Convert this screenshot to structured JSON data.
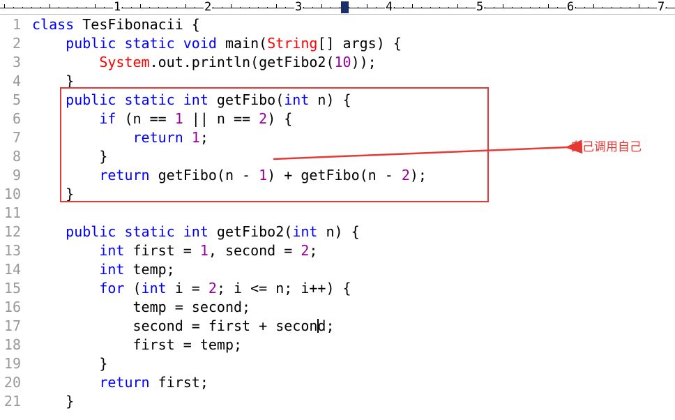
{
  "ruler": {
    "marks": [
      "1",
      "2",
      "3",
      "4",
      "5",
      "6",
      "7"
    ]
  },
  "editor": {
    "lines": [
      {
        "n": "1",
        "code": "class TesFibonacii {"
      },
      {
        "n": "2",
        "code": "    public static void main(String[] args) {"
      },
      {
        "n": "3",
        "code": "        System.out.println(getFibo2(10));"
      },
      {
        "n": "4",
        "code": "    }"
      },
      {
        "n": "5",
        "code": "    public static int getFibo(int n) {"
      },
      {
        "n": "6",
        "code": "        if (n == 1 || n == 2) {"
      },
      {
        "n": "7",
        "code": "            return 1;"
      },
      {
        "n": "8",
        "code": "        }"
      },
      {
        "n": "9",
        "code": "        return getFibo(n - 1) + getFibo(n - 2);"
      },
      {
        "n": "10",
        "code": "    }"
      },
      {
        "n": "11",
        "code": ""
      },
      {
        "n": "12",
        "code": "    public static int getFibo2(int n) {"
      },
      {
        "n": "13",
        "code": "        int first = 1, second = 2;"
      },
      {
        "n": "14",
        "code": "        int temp;"
      },
      {
        "n": "15",
        "code": "        for (int i = 2; i <= n; i++) {"
      },
      {
        "n": "16",
        "code": "            temp = second;"
      },
      {
        "n": "17",
        "code": "            second = first + second;"
      },
      {
        "n": "18",
        "code": "            first = temp;"
      },
      {
        "n": "19",
        "code": "        }"
      },
      {
        "n": "20",
        "code": "        return first;"
      },
      {
        "n": "21",
        "code": "    }"
      }
    ]
  },
  "annotation": {
    "text": "自己调用自己",
    "color": "#e53935"
  },
  "colors": {
    "keyword": "#0000ff",
    "class": "#ff0000",
    "number": "#990099",
    "line_number": "#999999"
  }
}
